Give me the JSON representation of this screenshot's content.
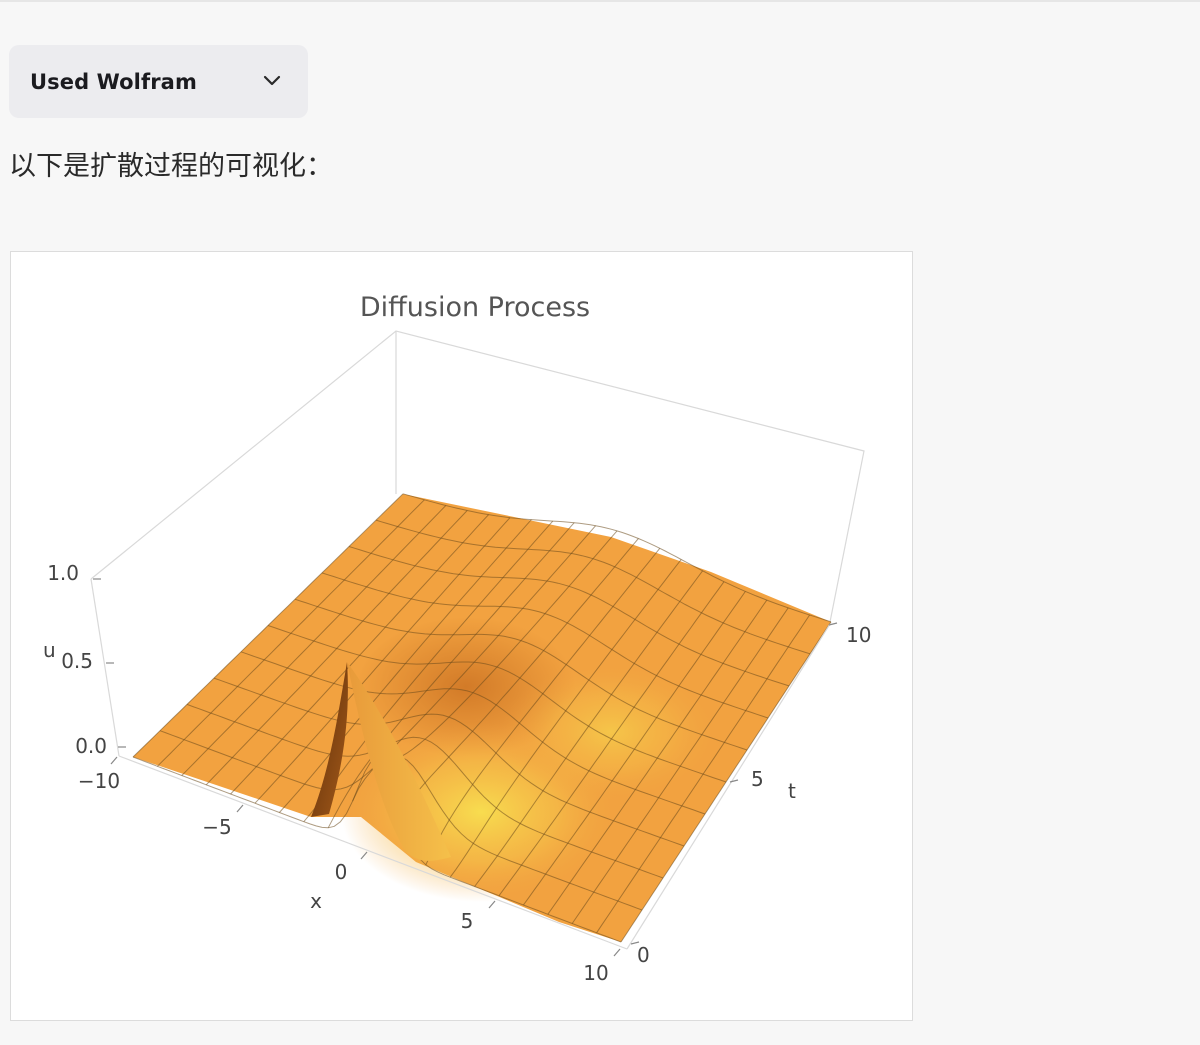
{
  "tool_call": {
    "label": "Used Wolfram",
    "icon": "chevron-down-icon"
  },
  "message": {
    "text": "以下是扩散过程的可视化："
  },
  "plot": {
    "title": "Diffusion Process",
    "z_axis_label": "u",
    "z_ticks": [
      "1.0",
      "0.5",
      "0.0"
    ],
    "x_axis_label": "x",
    "x_ticks": [
      "−10",
      "−5",
      "0",
      "5",
      "10"
    ],
    "t_axis_label": "t",
    "t_ticks": [
      "0",
      "5",
      "10"
    ],
    "surface_color": "#f2a240",
    "highlight_color": "#f8e050"
  },
  "chart_data": {
    "type": "surface3d",
    "title": "Diffusion Process",
    "xlabel": "x",
    "ylabel": "t",
    "zlabel": "u",
    "xlim": [
      -10,
      10
    ],
    "ylim": [
      0,
      10
    ],
    "zlim": [
      0,
      1
    ],
    "x_ticks": [
      -10,
      -5,
      0,
      5,
      10
    ],
    "y_ticks": [
      0,
      5,
      10
    ],
    "z_ticks": [
      0.0,
      0.5,
      1.0
    ],
    "grid_x": [
      -10,
      -9,
      -8,
      -7,
      -6,
      -5,
      -4,
      -3,
      -2,
      -1,
      0,
      1,
      2,
      3,
      4,
      5,
      6,
      7,
      8,
      9,
      10
    ],
    "grid_t": [
      0,
      1,
      2,
      3,
      4,
      5,
      6,
      7,
      8,
      9,
      10
    ],
    "peak": {
      "x": 0,
      "t": 0,
      "u": 0.6
    }
  }
}
